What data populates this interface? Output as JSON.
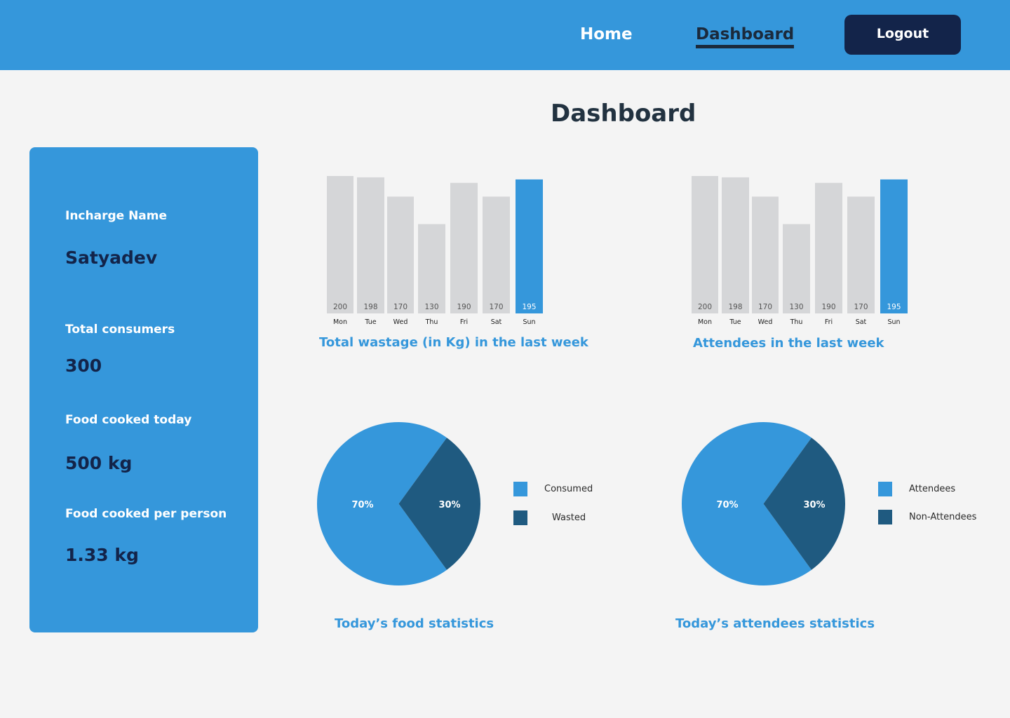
{
  "nav": {
    "home_label": "Home",
    "dashboard_label": "Dashboard",
    "logout_label": "Logout"
  },
  "page": {
    "title": "Dashboard"
  },
  "summary": {
    "incharge_label": "Incharge Name",
    "incharge_value": "Satyadev",
    "consumers_label": "Total consumers",
    "consumers_value": "300",
    "cooked_label": "Food cooked today",
    "cooked_value": "500 kg",
    "per_person_label": "Food cooked per person",
    "per_person_value": "1.33 kg"
  },
  "colors": {
    "primary": "#3597db",
    "dark_slice": "#1f5a80",
    "bar_gray": "#d5d6d8",
    "nav_dark": "#13244a"
  },
  "chart_data": [
    {
      "type": "bar",
      "title": "Total wastage (in Kg) in the last week",
      "categories": [
        "Mon",
        "Tue",
        "Wed",
        "Thu",
        "Fri",
        "Sat",
        "Sun"
      ],
      "values": [
        200,
        198,
        170,
        130,
        190,
        170,
        195
      ],
      "highlight_index": 6
    },
    {
      "type": "bar",
      "title": "Attendees in the last week",
      "categories": [
        "Mon",
        "Tue",
        "Wed",
        "Thu",
        "Fri",
        "Sat",
        "Sun"
      ],
      "values": [
        200,
        198,
        170,
        130,
        190,
        170,
        195
      ],
      "highlight_index": 6
    },
    {
      "type": "pie",
      "title": "Today’s food statistics",
      "slices": [
        {
          "label": "Consumed",
          "value": 70,
          "text": "70%"
        },
        {
          "label": "Wasted",
          "value": 30,
          "text": "30%"
        }
      ]
    },
    {
      "type": "pie",
      "title": "Today’s attendees statistics",
      "slices": [
        {
          "label": "Attendees",
          "value": 70,
          "text": "70%"
        },
        {
          "label": "Non-Attendees",
          "value": 30,
          "text": "30%"
        }
      ]
    }
  ]
}
